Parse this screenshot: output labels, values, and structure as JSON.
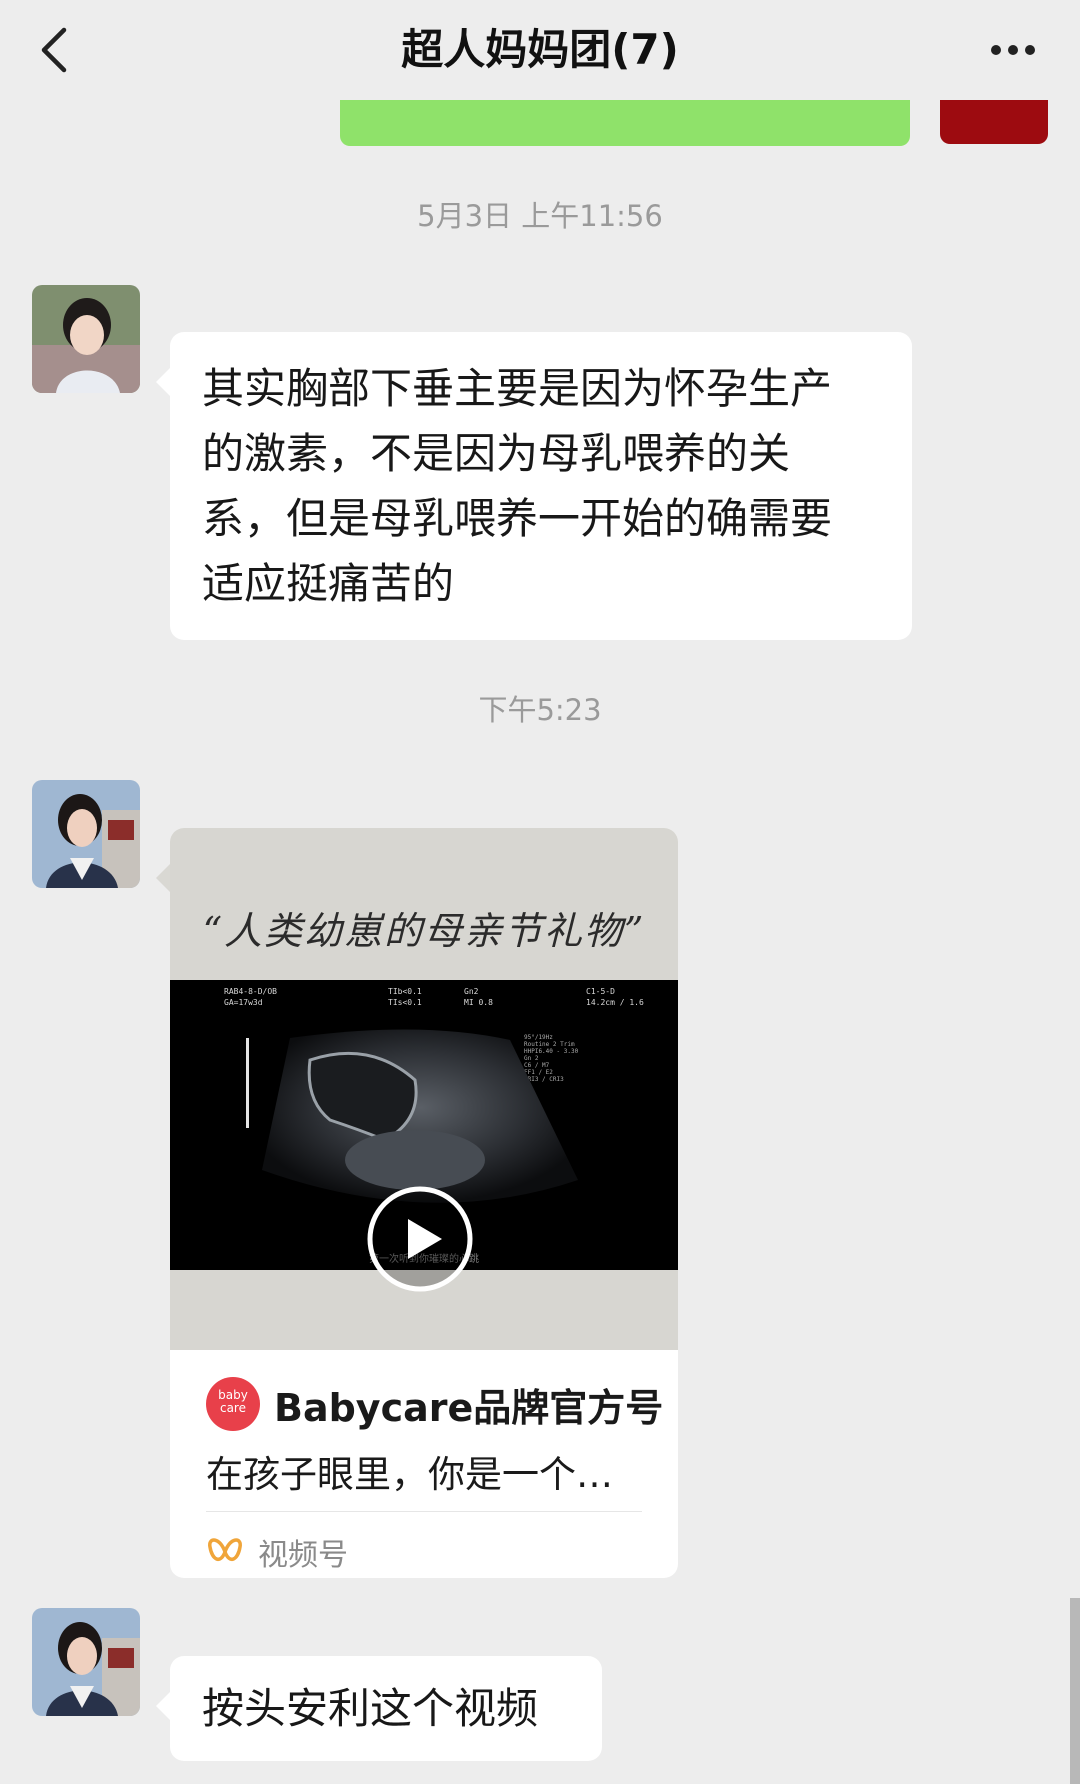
{
  "header": {
    "title": "超人妈妈团(7)",
    "back_icon": "chevron-left-icon",
    "more_icon": "ellipsis-icon"
  },
  "messages": [
    {
      "timestamp": "5月3日 上午11:56",
      "type": "text",
      "lines": [
        "其实胸部下垂主要是因为怀孕生产",
        "的激素，不是因为母乳喂养的关",
        "系，但是母乳喂养一开始的确需要",
        "适应挺痛苦的"
      ]
    },
    {
      "timestamp": "下午5:23",
      "type": "video-card",
      "video_caption": "“人类幼崽的母亲节礼物”",
      "scan_overlay": {
        "top_left": "RAB4-8-D/OB\nGA=17w3d",
        "top_mid": "TIb<0.1\nTIs<0.1",
        "top_mid2": "Gn2\nMI 0.8",
        "top_right": "C1-5-D\n14.2cm / 1.6",
        "side_info": "95°/19Hz\nRoutine 2 Trim\nHHPI6.40 - 3.30\nGn 2\nC6 / M7\nFF1 / E2\nSRI3 / CRI3",
        "bottom": "第一次听到你璀璨的心跳"
      },
      "brand_logo_text": "baby care",
      "brand": "Babycare品牌官方号",
      "description": "在孩子眼里，你是一个…",
      "source_icon": "channels-butterfly-icon",
      "source": "视频号"
    },
    {
      "type": "text",
      "lines": [
        "按头安利这个视频"
      ]
    }
  ],
  "colors": {
    "background": "#ededed",
    "bubble": "#ffffff",
    "self_bubble": "#8fe26a",
    "channels_icon": "#f0a53a",
    "brand_logo": "#e8404a"
  }
}
